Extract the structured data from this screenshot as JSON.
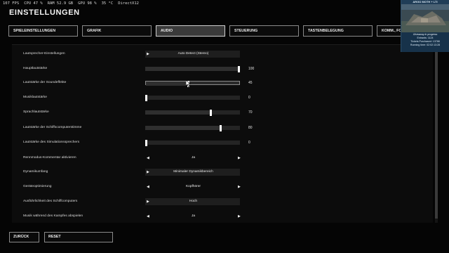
{
  "overlay": {
    "fps": "107 FPS",
    "cpu": "CPU 47 %",
    "ram": "RAM 52.9 GB",
    "gpu": "GPU 98 %",
    "gpu_temp": "35 °C",
    "api": "DirectX12"
  },
  "page_title": "EINSTELLUNGEN",
  "tabs": [
    "SPIELEINSTELLUNGEN",
    "GRAFIK",
    "AUDIO",
    "STEUERUNG",
    "TASTENBELEGUNG",
    "KOMM., FOIP, TOBII"
  ],
  "active_tab": "AUDIO",
  "settings": {
    "speaker": {
      "label": "Lautsprecher-Einstellungen",
      "value": "Auto Detect (Stereo)"
    },
    "master": {
      "label": "Hauptlautstärke",
      "value": "100",
      "level": 1.0
    },
    "sfx": {
      "label": "Lautstärke der Soundeffekte",
      "value": "45",
      "level": 0.45
    },
    "music": {
      "label": "Musiklautstärke",
      "value": "0",
      "level": 0.0
    },
    "voice": {
      "label": "Sprachlautstärke",
      "value": "70",
      "level": 0.7
    },
    "ship_ai": {
      "label": "Lautstärke der Schiffscomputerstimme",
      "value": "80",
      "level": 0.8
    },
    "sim_speaker": {
      "label": "Lautstärke des Simulationssprechers",
      "value": "0",
      "level": 0.0
    },
    "commentary": {
      "label": "Rennmodus-Kommentar aktivieren",
      "value": "Ja"
    },
    "dynamics": {
      "label": "Dynamikumfang",
      "value": "Minimaler Dynamikbereich"
    },
    "device": {
      "label": "Geräteoptimierung",
      "value": "Kopfhörer"
    },
    "verbosity": {
      "label": "Ausführlichkeit des Schiffcomputers",
      "value": "Hoch"
    },
    "fight_music": {
      "label": "Musik während des Kampfes abspielen",
      "value": "Ja"
    }
  },
  "buttons": {
    "back": "ZURÜCK",
    "reset": "RESET"
  },
  "stream": {
    "title": "ARGO MOTH + LTI",
    "line1": "Giveaway in progress",
    "line2": "Entrants: 1124",
    "line3": "Tickets Purchased: 13788",
    "line4": "Running time: 02:02:13:28"
  },
  "colors": {
    "active_tab": "#3a3a3a",
    "slider_thumb": "#ffffff",
    "stream_bg": "#17324a"
  },
  "icons": {
    "arrow_left": "◀",
    "arrow_right": "▶"
  }
}
